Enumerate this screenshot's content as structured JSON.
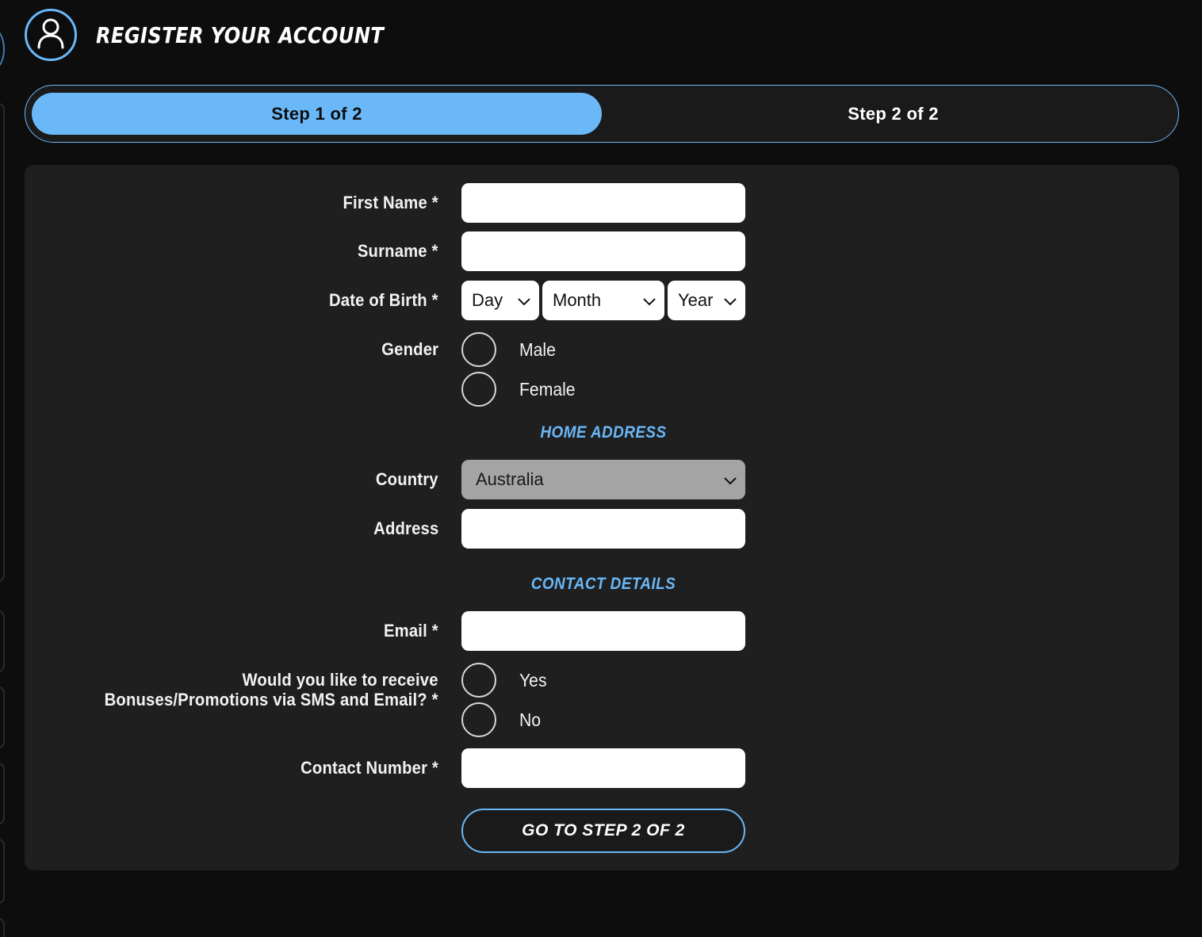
{
  "header": {
    "title": "REGISTER YOUR ACCOUNT",
    "icon": "user-icon"
  },
  "stepper": {
    "steps": [
      {
        "label": "Step 1 of 2",
        "active": true
      },
      {
        "label": "Step 2 of 2",
        "active": false
      }
    ]
  },
  "form": {
    "first_name": {
      "label": "First Name *",
      "value": ""
    },
    "surname": {
      "label": "Surname *",
      "value": ""
    },
    "dob": {
      "label": "Date of Birth *",
      "day": "Day",
      "month": "Month",
      "year": "Year"
    },
    "gender": {
      "label": "Gender",
      "options": [
        "Male",
        "Female"
      ]
    },
    "home_address_heading": "HOME ADDRESS",
    "country": {
      "label": "Country",
      "value": "Australia"
    },
    "address": {
      "label": "Address",
      "value": ""
    },
    "contact_heading": "CONTACT DETAILS",
    "email": {
      "label": "Email *",
      "value": ""
    },
    "promotions": {
      "label_line1": "Would you like to receive",
      "label_line2": "Bonuses/Promotions via SMS and Email? *",
      "options": [
        "Yes",
        "No"
      ]
    },
    "contact_number": {
      "label": "Contact Number *",
      "value": ""
    },
    "submit_label": "GO TO STEP 2 OF 2"
  },
  "colors": {
    "accent": "#6ab8f7",
    "background": "#0d0d0e",
    "card": "#1f1f20"
  }
}
